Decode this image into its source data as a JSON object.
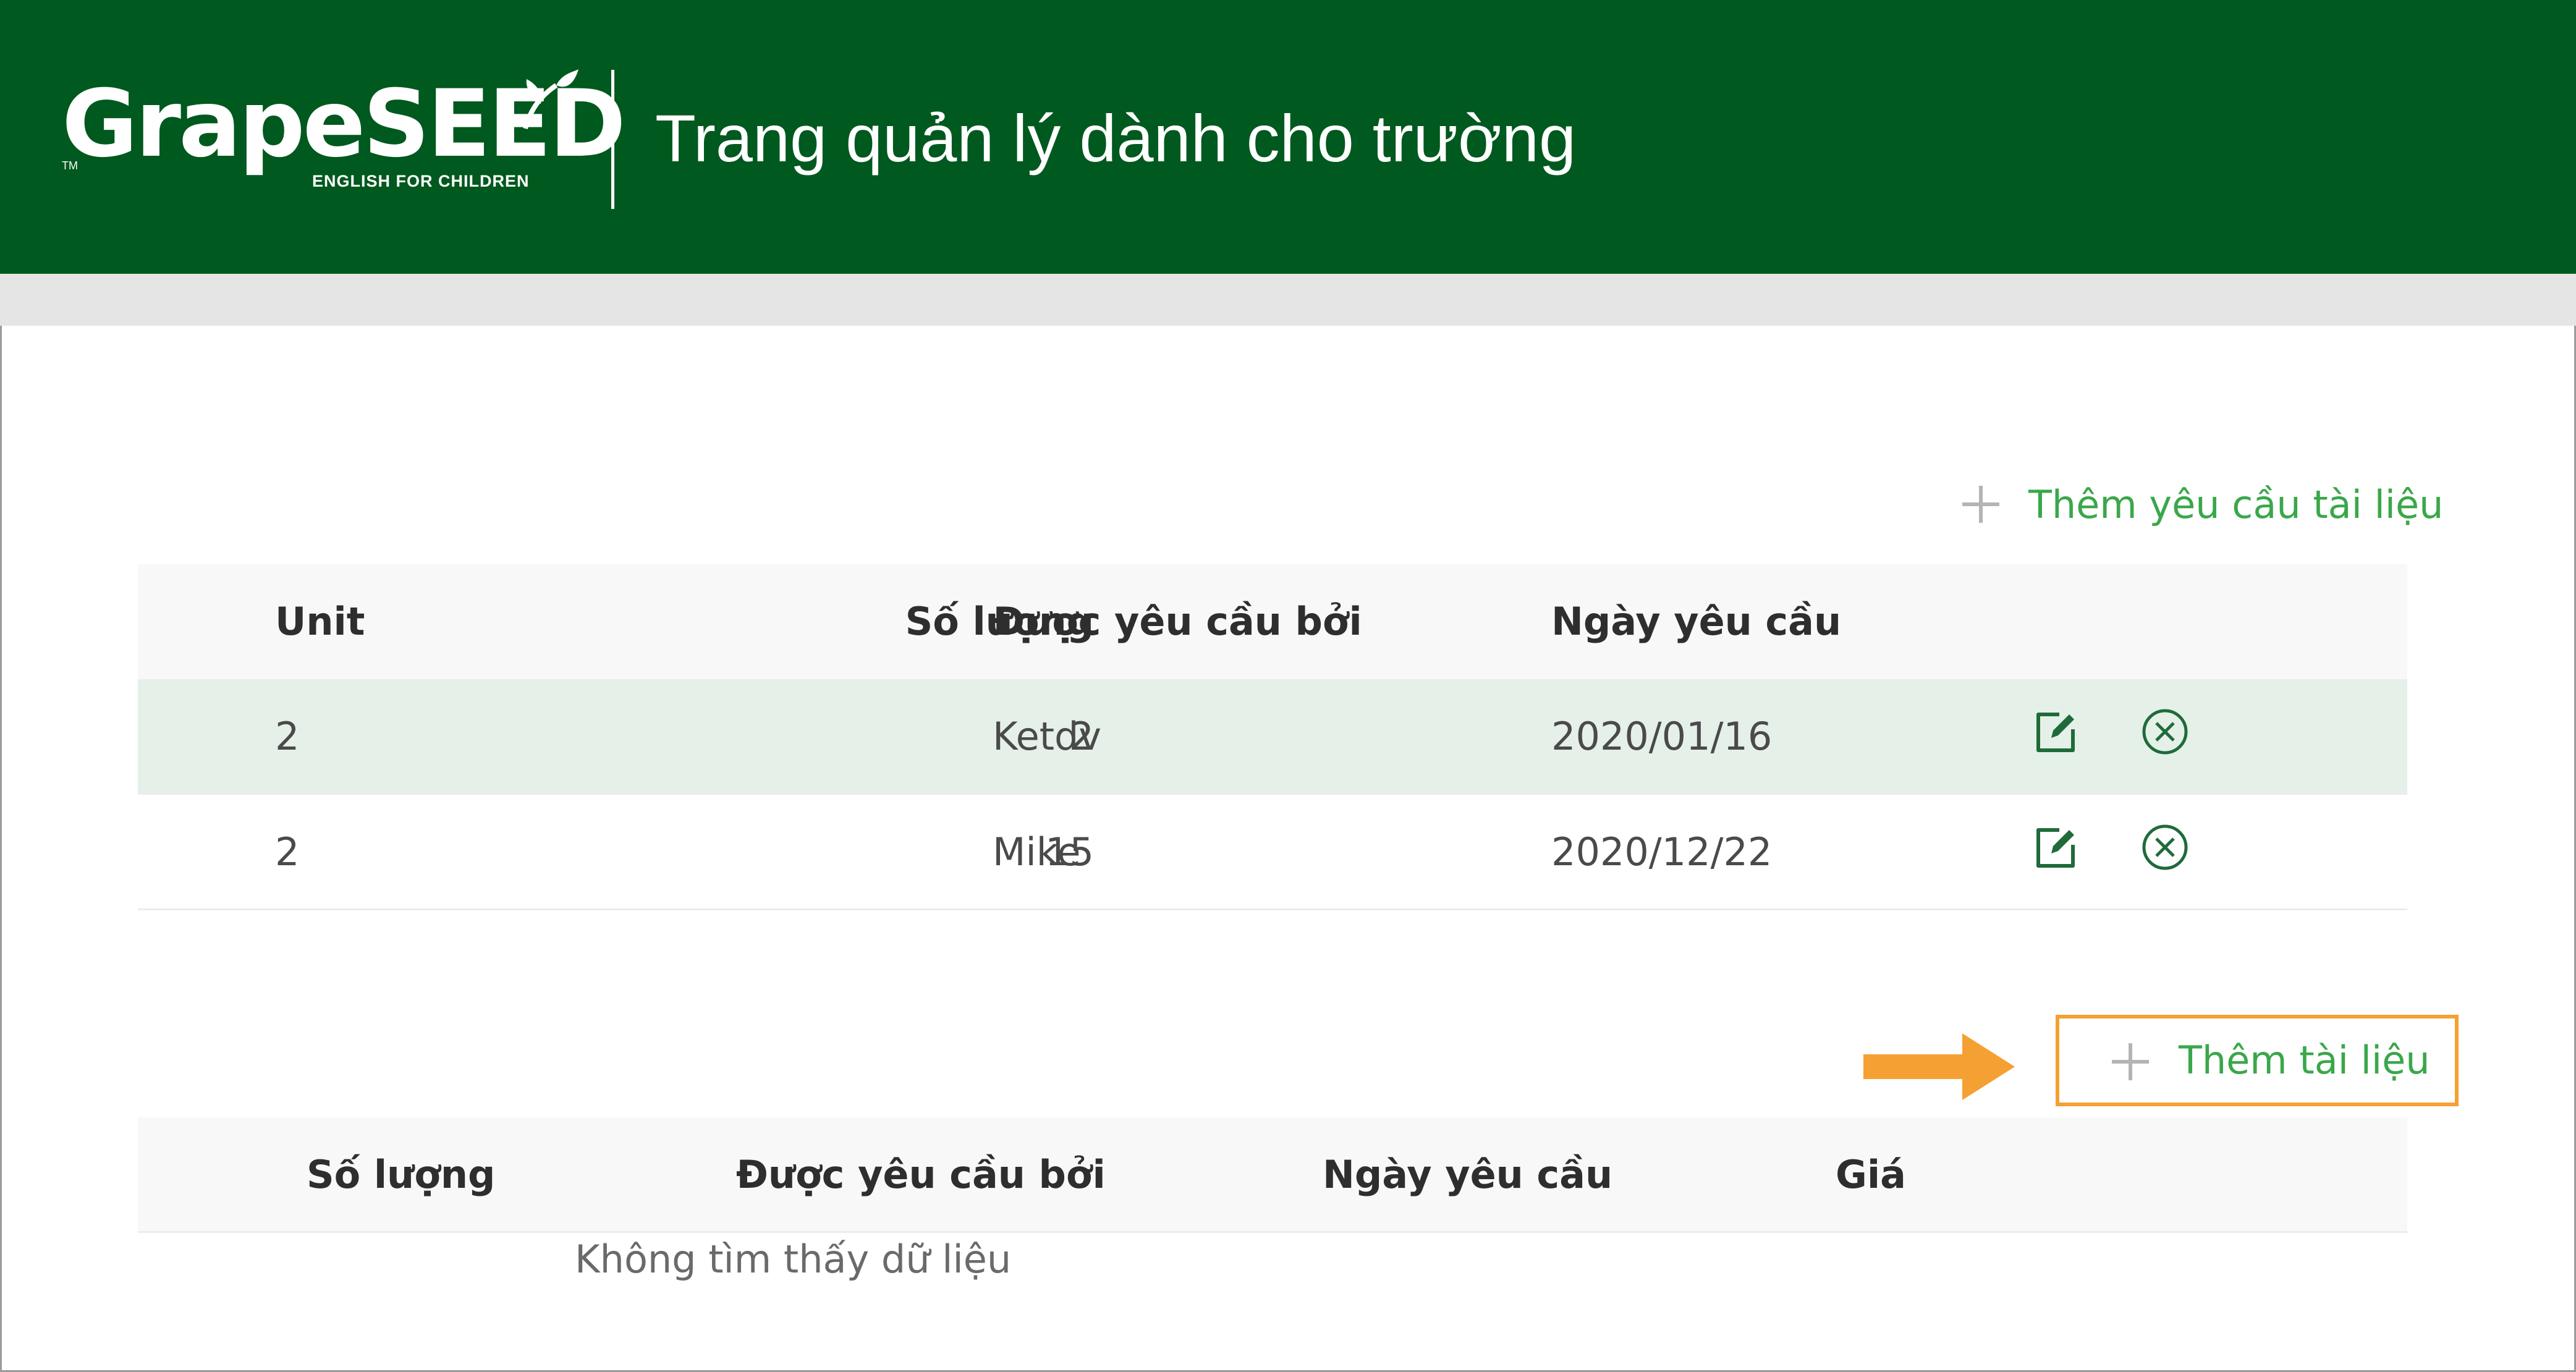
{
  "header": {
    "logo_word": "GrapeSEED",
    "logo_tagline": "ENGLISH FOR CHILDREN",
    "logo_tm": "TM",
    "title": "Trang quản lý dành cho trường",
    "background_color": "#00591e"
  },
  "requests": {
    "add_label": "Thêm yêu cầu tài liệu",
    "columns": {
      "unit": "Unit",
      "quantity": "Số lượng",
      "requested_by": "Được yêu cầu bởi",
      "request_date": "Ngày yêu cầu"
    },
    "rows": [
      {
        "unit": "2",
        "quantity": "2",
        "requested_by": "Ketdv",
        "request_date": "2020/01/16",
        "highlighted": true
      },
      {
        "unit": "2",
        "quantity": "15",
        "requested_by": "Mike",
        "request_date": "2020/12/22",
        "highlighted": false
      }
    ],
    "row_actions": [
      "edit-icon",
      "delete-circle-x-icon"
    ]
  },
  "materials": {
    "add_label": "Thêm tài liệu",
    "columns": {
      "quantity": "Số lượng",
      "requested_by": "Được yêu cầu bởi",
      "request_date": "Ngày yêu cầu",
      "price": "Giá"
    },
    "empty_message": "Không tìm thấy dữ liệu"
  },
  "colors": {
    "brand_green": "#00591e",
    "link_green": "#3aa74a",
    "highlight_row": "#e5f0e8",
    "callout_orange": "#f5a032"
  }
}
